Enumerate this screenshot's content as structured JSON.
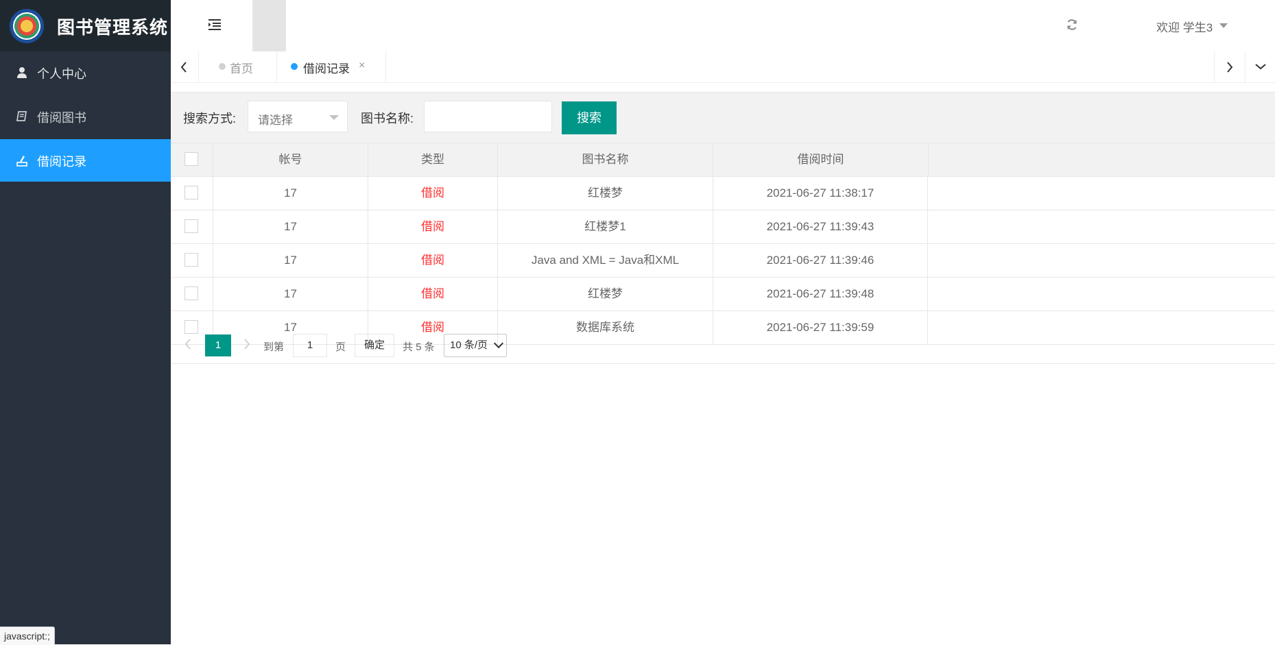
{
  "app": {
    "title": "图书管理系统"
  },
  "sidebar": {
    "items": [
      {
        "label": "个人中心",
        "icon": "user-icon"
      },
      {
        "label": "借阅图书",
        "icon": "book-icon"
      },
      {
        "label": "借阅记录",
        "icon": "record-icon",
        "active": true
      }
    ]
  },
  "header": {
    "welcome": "欢迎 学生3"
  },
  "tabs": [
    {
      "label": "首页"
    },
    {
      "label": "借阅记录",
      "close": "×"
    }
  ],
  "search": {
    "mode_label": "搜索方式:",
    "mode_placeholder": "请选择",
    "name_label": "图书名称:",
    "button": "搜索"
  },
  "table": {
    "headers": [
      "帐号",
      "类型",
      "图书名称",
      "借阅时间"
    ],
    "rows": [
      {
        "account": "17",
        "type": "借阅",
        "book": "红楼梦",
        "time": "2021-06-27 11:38:17"
      },
      {
        "account": "17",
        "type": "借阅",
        "book": "红楼梦1",
        "time": "2021-06-27 11:39:43"
      },
      {
        "account": "17",
        "type": "借阅",
        "book": "Java and XML = Java和XML",
        "time": "2021-06-27 11:39:46"
      },
      {
        "account": "17",
        "type": "借阅",
        "book": "红楼梦",
        "time": "2021-06-27 11:39:48"
      },
      {
        "account": "17",
        "type": "借阅",
        "book": "数据库系统",
        "time": "2021-06-27 11:39:59"
      }
    ]
  },
  "pager": {
    "current": "1",
    "goto": "到第",
    "goto_value": "1",
    "page": "页",
    "confirm": "确定",
    "total": "共 5 条",
    "page_size": "10 条/页"
  },
  "status_bar": "javascript:;",
  "colors": {
    "sidebar": "#28313d",
    "active": "#1e9fff",
    "primary": "#009688",
    "type": "#ff2d2d"
  }
}
